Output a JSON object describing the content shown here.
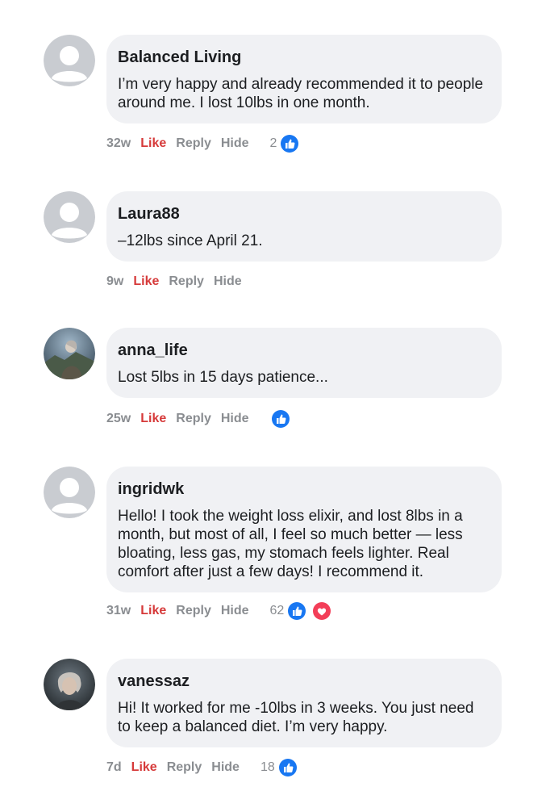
{
  "comments": [
    {
      "author": "Balanced Living",
      "text": "I’m very happy and already recommended it to people around me. I lost 10lbs in one month.",
      "time": "32w",
      "like": "Like",
      "reply": "Reply",
      "hide": "Hide",
      "reaction_count": "2",
      "reactions": [
        "like-icon"
      ],
      "avatar": "default-avatar-icon"
    },
    {
      "author": "Laura88",
      "text": "–12lbs since April 21.",
      "time": "9w",
      "like": "Like",
      "reply": "Reply",
      "hide": "Hide",
      "reaction_count": "",
      "reactions": [],
      "avatar": "default-avatar-icon"
    },
    {
      "author": "anna_life",
      "text": "Lost 5lbs in 15 days patience...",
      "time": "25w",
      "like": "Like",
      "reply": "Reply",
      "hide": "Hide",
      "reaction_count": "",
      "reactions": [
        "like-icon"
      ],
      "avatar": "photo-avatar"
    },
    {
      "author": "ingridwk",
      "text": "Hello! I took the weight loss elixir, and lost 8lbs in a month, but most of all, I feel so much better — less bloating, less gas, my stomach feels lighter. Real comfort after just a few days! I recommend it.",
      "time": "31w",
      "like": "Like",
      "reply": "Reply",
      "hide": "Hide",
      "reaction_count": "62",
      "reactions": [
        "like-icon",
        "love-icon"
      ],
      "avatar": "default-avatar-icon"
    },
    {
      "author": "vanessaz",
      "text": "Hi! It worked for me -10lbs in 3 weeks. You just need to keep a balanced diet. I’m very happy.",
      "time": "7d",
      "like": "Like",
      "reply": "Reply",
      "hide": "Hide",
      "reaction_count": "18",
      "reactions": [
        "like-icon"
      ],
      "avatar": "photo-avatar"
    }
  ],
  "colors": {
    "like_red": "#d63a3a",
    "meta_gray": "#8a8d91",
    "bubble_bg": "#f0f1f4",
    "like_blue": "#1877f2",
    "love_red": "#f33e58"
  }
}
